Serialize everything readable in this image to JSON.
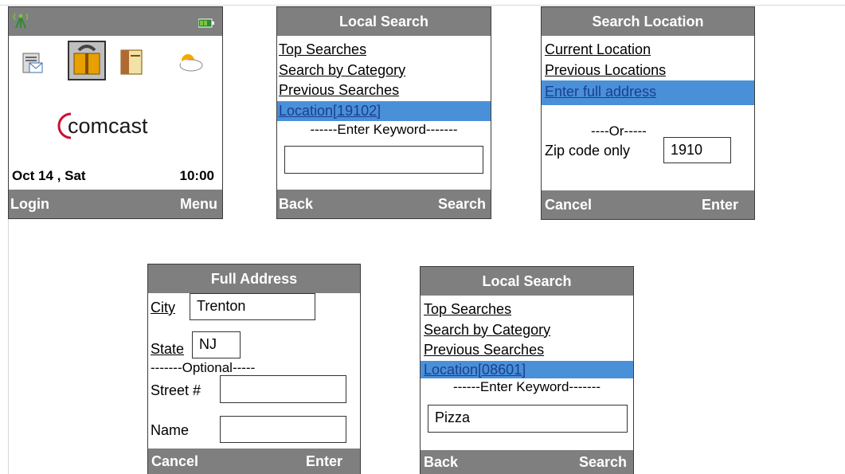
{
  "home": {
    "brand": "comcast",
    "date": "Oct 14 , Sat",
    "time": "10:00",
    "soft_left": "Login",
    "soft_right": "Menu",
    "icons": [
      "signal-icon",
      "battery-icon",
      "mail-icon",
      "phonebook-icon",
      "notebook-icon",
      "weather-icon"
    ]
  },
  "local_search_1": {
    "title": "Local Search",
    "items": [
      "Top Searches",
      "Search by Category",
      "Previous Searches",
      "Location[19102]"
    ],
    "separator": "------Enter Keyword-------",
    "keyword_value": "",
    "soft_left": "Back",
    "soft_right": "Search"
  },
  "search_location": {
    "title": "Search Location",
    "items": [
      "Current Location",
      "Previous Locations",
      "Enter full address"
    ],
    "or_text": "----Or-----",
    "zip_label": "Zip code only",
    "zip_value": "1910",
    "soft_left": "Cancel",
    "soft_right": "Enter"
  },
  "full_address": {
    "title": "Full Address",
    "city_label": "City",
    "city_value": "Trenton",
    "state_label": "State",
    "state_value": "NJ",
    "optional_text": "-------Optional-----",
    "street_label": "Street #",
    "street_value": "",
    "name_label": "Name",
    "name_value": "",
    "soft_left": "Cancel",
    "soft_right": "Enter"
  },
  "local_search_2": {
    "title": "Local Search",
    "items": [
      "Top Searches",
      "Search by Category",
      "Previous Searches",
      "Location[08601]"
    ],
    "separator": "------Enter Keyword-------",
    "keyword_value": "Pizza",
    "soft_left": "Back",
    "soft_right": "Search"
  },
  "colors": {
    "bar_gray": "#7f7f7f",
    "selection_blue": "#4a90d9",
    "brand_red": "#c8102e"
  }
}
